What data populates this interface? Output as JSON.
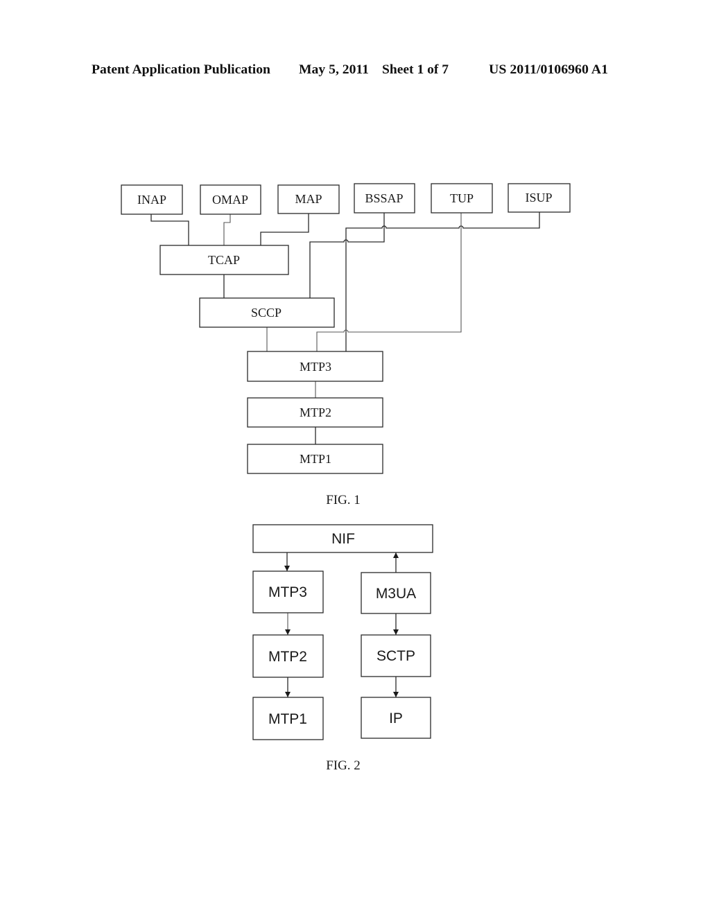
{
  "header": {
    "publication_type": "Patent Application Publication",
    "date": "May 5, 2011",
    "sheet": "Sheet 1 of 7",
    "publication_number": "US 2011/0106960 A1"
  },
  "figure_1": {
    "caption": "FIG. 1",
    "boxes": {
      "inap": "INAP",
      "omap": "OMAP",
      "map": "MAP",
      "bssap": "BSSAP",
      "tup": "TUP",
      "isup": "ISUP",
      "tcap": "TCAP",
      "sccp": "SCCP",
      "mtp3": "MTP3",
      "mtp2": "MTP2",
      "mtp1": "MTP1"
    },
    "edges": [
      {
        "from": "INAP",
        "to": "TCAP"
      },
      {
        "from": "OMAP",
        "to": "TCAP"
      },
      {
        "from": "MAP",
        "to": "TCAP"
      },
      {
        "from": "TCAP",
        "to": "SCCP"
      },
      {
        "from": "BSSAP",
        "to": "SCCP"
      },
      {
        "from": "SCCP",
        "to": "MTP3"
      },
      {
        "from": "TUP",
        "to": "MTP3"
      },
      {
        "from": "ISUP",
        "to": "MTP3"
      },
      {
        "from": "MTP3",
        "to": "MTP2"
      },
      {
        "from": "MTP2",
        "to": "MTP1"
      }
    ]
  },
  "figure_2": {
    "caption": "FIG. 2",
    "boxes": {
      "nif": "NIF",
      "mtp3": "MTP3",
      "mtp2": "MTP2",
      "mtp1": "MTP1",
      "m3ua": "M3UA",
      "sctp": "SCTP",
      "ip": "IP"
    },
    "edges": [
      {
        "from": "NIF",
        "to": "MTP3",
        "directed": true
      },
      {
        "from": "MTP3",
        "to": "MTP2",
        "directed": true
      },
      {
        "from": "MTP2",
        "to": "MTP1",
        "directed": true
      },
      {
        "from": "M3UA",
        "to": "NIF",
        "directed": true
      },
      {
        "from": "M3UA",
        "to": "SCTP",
        "directed": true
      },
      {
        "from": "SCTP",
        "to": "IP",
        "directed": true
      }
    ]
  }
}
